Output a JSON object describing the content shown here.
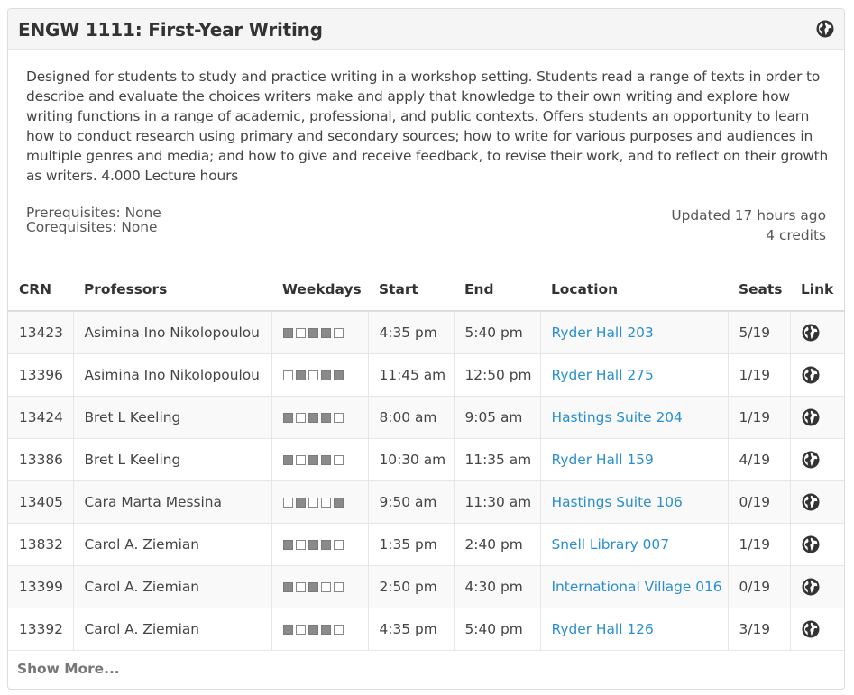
{
  "course": {
    "title": "ENGW 1111: First-Year Writing",
    "description": "Designed for students to study and practice writing in a workshop setting. Students read a range of texts in order to describe and evaluate the choices writers make and apply that knowledge to their own writing and explore how writing functions in a range of academic, professional, and public contexts. Offers students an opportunity to learn how to conduct research using primary and secondary sources; how to write for various purposes and audiences in multiple genres and media; and how to give and receive feedback, to revise their work, and to reflect on their growth as writers. 4.000 Lecture hours",
    "prerequisites": "Prerequisites: None",
    "corequisites": "Corequisites: None",
    "updated": "Updated 17 hours ago",
    "credits": "4 credits"
  },
  "table": {
    "headers": {
      "crn": "CRN",
      "professors": "Professors",
      "weekdays": "Weekdays",
      "start": "Start",
      "end": "End",
      "location": "Location",
      "seats": "Seats",
      "link": "Link"
    },
    "rows": [
      {
        "crn": "13423",
        "professor": "Asimina Ino Nikolopoulou",
        "days": [
          1,
          0,
          1,
          1,
          0
        ],
        "start": "4:35 pm",
        "end": "5:40 pm",
        "location": "Ryder Hall 203",
        "seats": "5/19"
      },
      {
        "crn": "13396",
        "professor": "Asimina Ino Nikolopoulou",
        "days": [
          0,
          1,
          0,
          1,
          1
        ],
        "start": "11:45 am",
        "end": "12:50 pm",
        "location": "Ryder Hall 275",
        "seats": "1/19"
      },
      {
        "crn": "13424",
        "professor": "Bret L Keeling",
        "days": [
          1,
          0,
          1,
          1,
          0
        ],
        "start": "8:00 am",
        "end": "9:05 am",
        "location": "Hastings Suite 204",
        "seats": "1/19"
      },
      {
        "crn": "13386",
        "professor": "Bret L Keeling",
        "days": [
          1,
          0,
          1,
          1,
          0
        ],
        "start": "10:30 am",
        "end": "11:35 am",
        "location": "Ryder Hall 159",
        "seats": "4/19"
      },
      {
        "crn": "13405",
        "professor": "Cara Marta Messina",
        "days": [
          0,
          1,
          0,
          0,
          1
        ],
        "start": "9:50 am",
        "end": "11:30 am",
        "location": "Hastings Suite 106",
        "seats": "0/19"
      },
      {
        "crn": "13832",
        "professor": "Carol A. Ziemian",
        "days": [
          1,
          0,
          1,
          1,
          0
        ],
        "start": "1:35 pm",
        "end": "2:40 pm",
        "location": "Snell Library 007",
        "seats": "1/19"
      },
      {
        "crn": "13399",
        "professor": "Carol A. Ziemian",
        "days": [
          1,
          0,
          1,
          0,
          0
        ],
        "start": "2:50 pm",
        "end": "4:30 pm",
        "location": "International Village 016",
        "seats": "0/19"
      },
      {
        "crn": "13392",
        "professor": "Carol A. Ziemian",
        "days": [
          1,
          0,
          1,
          1,
          0
        ],
        "start": "4:35 pm",
        "end": "5:40 pm",
        "location": "Ryder Hall 126",
        "seats": "3/19"
      }
    ],
    "link_icon": "globe-icon"
  },
  "footer": {
    "show_more": "Show More..."
  },
  "colors": {
    "link": "#2a8fd0",
    "day_on": "#8a8a8a",
    "header_bg": "#f5f5f5"
  }
}
